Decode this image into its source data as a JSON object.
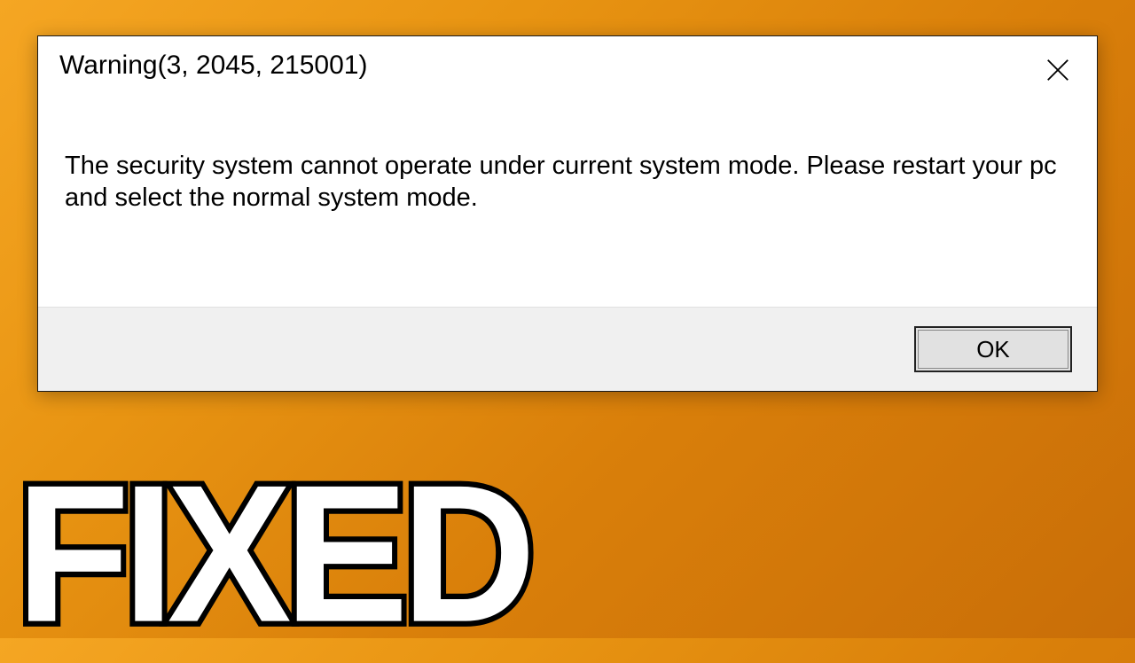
{
  "dialog": {
    "title": "Warning(3, 2045, 215001)",
    "message": "The security system cannot operate under current system mode. Please restart your pc and select the normal system mode.",
    "ok_label": "OK"
  },
  "overlay": {
    "text": "FIXED"
  }
}
